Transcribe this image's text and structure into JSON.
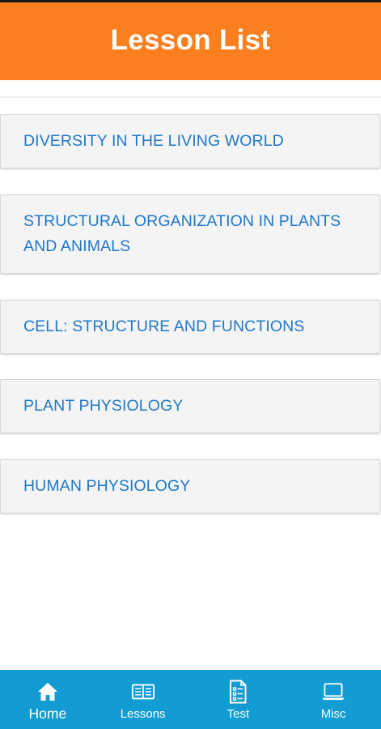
{
  "header": {
    "title": "Lesson List"
  },
  "lessons": [
    {
      "label": "DIVERSITY IN THE LIVING WORLD"
    },
    {
      "label": "STRUCTURAL ORGANIZATION IN PLANTS AND ANIMALS"
    },
    {
      "label": "CELL: STRUCTURE AND FUNCTIONS"
    },
    {
      "label": "PLANT PHYSIOLOGY"
    },
    {
      "label": "HUMAN PHYSIOLOGY"
    }
  ],
  "bottom_nav": {
    "items": [
      {
        "label": "Home",
        "icon": "home-icon",
        "active": true
      },
      {
        "label": "Lessons",
        "icon": "book-icon",
        "active": false
      },
      {
        "label": "Test",
        "icon": "checklist-icon",
        "active": false
      },
      {
        "label": "Misc",
        "icon": "laptop-icon",
        "active": false
      }
    ]
  },
  "colors": {
    "header_bg": "#fb7f1f",
    "nav_bg": "#139bd3",
    "link_text": "#1f78c9",
    "card_bg": "#f4f4f4"
  }
}
